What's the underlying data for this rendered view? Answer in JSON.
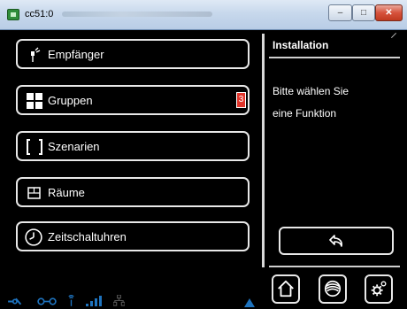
{
  "window": {
    "title": "cc51:0",
    "buttons": {
      "minimize": "–",
      "maximize": "□",
      "close": "✕"
    }
  },
  "menu": [
    {
      "label": "Empfänger",
      "icon": "plug-icon"
    },
    {
      "label": "Gruppen",
      "icon": "group-grid-icon",
      "badge": "3"
    },
    {
      "label": "Szenarien",
      "icon": "brackets-icon"
    },
    {
      "label": "Räume",
      "icon": "room-icon"
    },
    {
      "label": "Zeitschaltuhren",
      "icon": "clock-icon"
    }
  ],
  "panel": {
    "title": "Installation",
    "text_line1": "Bitte wählen Sie",
    "text_line2": "eine Funktion"
  },
  "colors": {
    "accent": "#1e73be",
    "badge": "#e0342a",
    "border": "#e8e8e8"
  }
}
